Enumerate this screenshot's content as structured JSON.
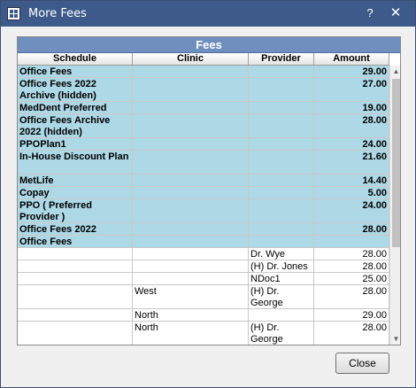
{
  "window": {
    "title": "More Fees",
    "help": "?",
    "close": "✕",
    "icon": "grid-app-icon"
  },
  "grid": {
    "title": "Fees",
    "columns": {
      "schedule": "Schedule",
      "clinic": "Clinic",
      "provider": "Provider",
      "amount": "Amount"
    },
    "rows": [
      {
        "type": "sched",
        "schedule": "Office Fees",
        "clinic": "",
        "provider": "",
        "amount": "29.00"
      },
      {
        "type": "sched",
        "schedule": "Office Fees 2022 Archive (hidden)",
        "clinic": "",
        "provider": "",
        "amount": "27.00"
      },
      {
        "type": "sched",
        "schedule": "MedDent Preferred",
        "clinic": "",
        "provider": "",
        "amount": "19.00"
      },
      {
        "type": "sched",
        "schedule": "Office Fees Archive 2022 (hidden)",
        "clinic": "",
        "provider": "",
        "amount": "28.00"
      },
      {
        "type": "sched",
        "schedule": "PPOPlan1",
        "clinic": "",
        "provider": "",
        "amount": "24.00"
      },
      {
        "type": "sched",
        "schedule": "In-House Discount Plan",
        "clinic": "",
        "provider": "",
        "amount": "21.60"
      },
      {
        "type": "sched",
        "schedule": "MetLife",
        "clinic": "",
        "provider": "",
        "amount": "14.40"
      },
      {
        "type": "sched",
        "schedule": "Copay",
        "clinic": "",
        "provider": "",
        "amount": "5.00"
      },
      {
        "type": "sched",
        "schedule": "PPO ( Preferred Provider )",
        "clinic": "",
        "provider": "",
        "amount": "24.00"
      },
      {
        "type": "sched",
        "schedule": "Office Fees 2022",
        "clinic": "",
        "provider": "",
        "amount": "28.00"
      },
      {
        "type": "sched",
        "schedule": "Office Fees",
        "clinic": "",
        "provider": "",
        "amount": ""
      },
      {
        "type": "fee",
        "schedule": "",
        "clinic": "",
        "provider": "Dr. Wye",
        "amount": "28.00"
      },
      {
        "type": "fee",
        "schedule": "",
        "clinic": "",
        "provider": "(H) Dr. Jones",
        "amount": "28.00"
      },
      {
        "type": "fee",
        "schedule": "",
        "clinic": "",
        "provider": "NDoc1",
        "amount": "25.00"
      },
      {
        "type": "fee",
        "schedule": "",
        "clinic": "West",
        "provider": "(H) Dr. George",
        "amount": "28.00"
      },
      {
        "type": "fee",
        "schedule": "",
        "clinic": "North",
        "provider": "",
        "amount": "29.00"
      },
      {
        "type": "fee",
        "schedule": "",
        "clinic": "North",
        "provider": "(H) Dr. George",
        "amount": "28.00"
      }
    ]
  },
  "buttons": {
    "close": "Close"
  },
  "colors": {
    "titlebar": "#3d5a8a",
    "schedule_row": "#add8e6",
    "grid_title": "#6f8fbf"
  }
}
